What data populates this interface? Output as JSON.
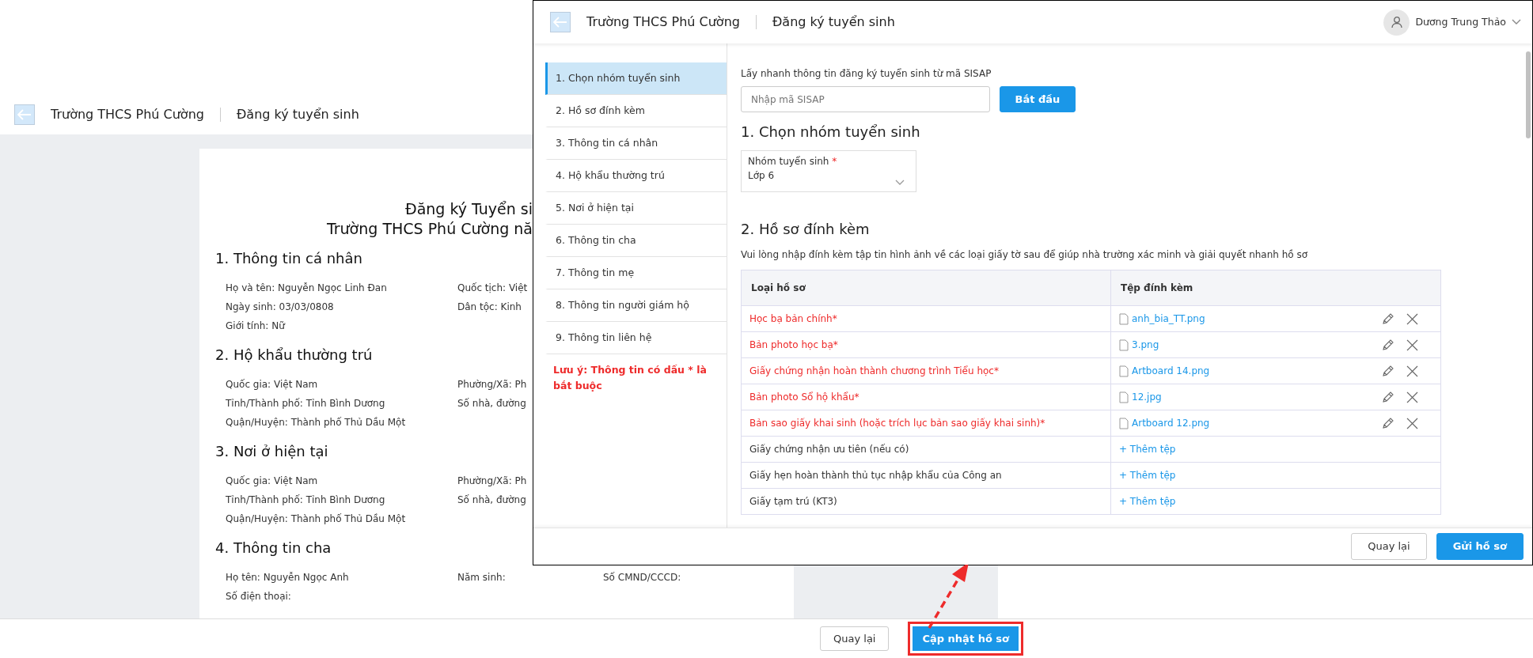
{
  "background_page": {
    "header": {
      "school": "Trường THCS Phú Cường",
      "page_title": "Đăng ký tuyển sinh"
    },
    "document": {
      "title_lines": [
        "Đăng ký Tuyển si",
        "Trường THCS Phú Cường nă"
      ],
      "sections": [
        {
          "heading": "1. Thông tin cá nhân",
          "rows": [
            [
              "Họ và tên: Nguyễn Ngọc Linh Đan",
              "Quốc tịch: Việt"
            ],
            [
              "Ngày sinh: 03/03/0808",
              "Dân tộc: Kinh"
            ],
            [
              "Giới tính: Nữ"
            ]
          ]
        },
        {
          "heading": "2. Hộ khẩu thường trú",
          "rows": [
            [
              "Quốc gia: Việt Nam",
              "Phường/Xã: Ph"
            ],
            [
              "Tỉnh/Thành phố: Tỉnh Bình Dương",
              "Số nhà, đường"
            ],
            [
              "Quận/Huyện: Thành phố Thủ Dầu Một"
            ]
          ]
        },
        {
          "heading": "3. Nơi ở hiện tại",
          "rows": [
            [
              "Quốc gia: Việt Nam",
              "Phường/Xã: Ph"
            ],
            [
              "Tỉnh/Thành phố: Tỉnh Bình Dương",
              "Số nhà, đường"
            ],
            [
              "Quận/Huyện: Thành phố Thủ Dầu Một"
            ]
          ]
        },
        {
          "heading": "4. Thông tin cha",
          "rows": [
            [
              "Họ tên: Nguyễn Ngọc Anh",
              "Năm sinh:",
              "Số CMND/CCCD:"
            ],
            [
              "Số điện thoại:"
            ]
          ]
        }
      ]
    },
    "buttons": [
      {
        "label": "Quay lại",
        "kind": "secondary",
        "highlighted": false
      },
      {
        "label": "Cập nhật hồ sơ",
        "kind": "primary",
        "highlighted": true
      }
    ]
  },
  "dialog": {
    "header": {
      "school": "Trường THCS Phú Cường",
      "page_title": "Đăng ký tuyển sinh",
      "user_name": "Dương Trung Thảo"
    },
    "sidebar": {
      "items": [
        {
          "label": "1. Chọn nhóm tuyển sinh",
          "selected": true
        },
        {
          "label": "2. Hồ sơ đính kèm",
          "selected": false
        },
        {
          "label": "3. Thông tin cá nhân",
          "selected": false
        },
        {
          "label": "4. Hộ khẩu thường trú",
          "selected": false
        },
        {
          "label": "5. Nơi ở hiện tại",
          "selected": false
        },
        {
          "label": "6. Thông tin cha",
          "selected": false
        },
        {
          "label": "7. Thông tin mẹ",
          "selected": false
        },
        {
          "label": "8. Thông tin người giám hộ",
          "selected": false
        },
        {
          "label": "9. Thông tin liên hệ",
          "selected": false
        }
      ],
      "note": "Lưu ý: Thông tin có dấu * là bắt buộc"
    },
    "sisap": {
      "label": "Lấy nhanh thông tin đăng ký tuyển sinh từ mã SISAP",
      "placeholder": "Nhập mã SISAP",
      "button": "Bắt đầu"
    },
    "group_section": {
      "heading": "1. Chọn nhóm tuyển sinh",
      "select": {
        "label": "Nhóm tuyển sinh",
        "required_mark": "*",
        "value": "Lớp 6"
      }
    },
    "attachments": {
      "heading": "2. Hồ sơ đính kèm",
      "description": "Vui lòng nhập đính kèm tập tin hình ảnh về các loại giấy tờ sau để giúp nhà trường xác minh và giải quyết nhanh hồ sơ",
      "table": {
        "columns": [
          "Loại hồ sơ",
          "Tệp đính kèm"
        ],
        "rows": [
          {
            "type": "Học bạ bản chính*",
            "required": true,
            "kind": "file",
            "file": "anh_bia_TT.png"
          },
          {
            "type": "Bản photo học bạ*",
            "required": true,
            "kind": "file",
            "file": "3.png"
          },
          {
            "type": "Giấy chứng nhận hoàn thành chương trình Tiểu học*",
            "required": true,
            "kind": "file",
            "file": "Artboard 14.png"
          },
          {
            "type": "Bản photo Sổ hộ khẩu*",
            "required": true,
            "kind": "file",
            "file": "12.jpg"
          },
          {
            "type": "Bản sao giấy khai sinh (hoặc trích lục bản sao giấy khai sinh)*",
            "required": true,
            "kind": "file",
            "file": "Artboard 12.png"
          },
          {
            "type": "Giấy chứng nhận ưu tiên (nếu có)",
            "required": false,
            "kind": "add",
            "action": "+ Thêm tệp"
          },
          {
            "type": "Giấy hẹn hoàn thành thủ tục nhập khẩu của Công an",
            "required": false,
            "kind": "add",
            "action": "+ Thêm tệp"
          },
          {
            "type": "Giấy tạm trú (KT3)",
            "required": false,
            "kind": "add",
            "action": "+ Thêm tệp"
          }
        ]
      }
    },
    "buttons": [
      {
        "label": "Quay lại",
        "kind": "secondary"
      },
      {
        "label": "Gửi hồ sơ",
        "kind": "primary"
      }
    ]
  }
}
